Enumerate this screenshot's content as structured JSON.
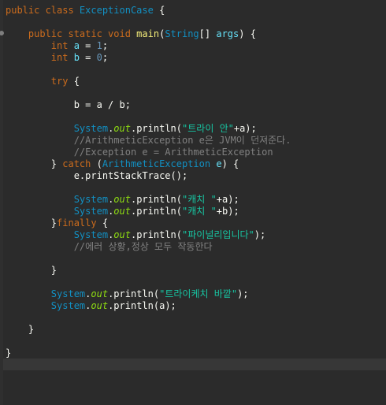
{
  "editor": {
    "language": "java",
    "background": "#2b2b2b",
    "lines": [
      {
        "segments": [
          {
            "t": "public class ",
            "c": "kw"
          },
          {
            "t": "ExceptionCase",
            "c": "cls"
          },
          {
            "t": " {",
            "c": "plain"
          }
        ]
      },
      {
        "segments": []
      },
      {
        "segments": [
          {
            "t": "    public static void ",
            "c": "kw"
          },
          {
            "t": "main",
            "c": "hlv"
          },
          {
            "t": "(",
            "c": "plain"
          },
          {
            "t": "String",
            "c": "cls"
          },
          {
            "t": "[] ",
            "c": "plain"
          },
          {
            "t": "args",
            "c": "var"
          },
          {
            "t": ") {",
            "c": "plain"
          }
        ]
      },
      {
        "segments": [
          {
            "t": "        int ",
            "c": "kw"
          },
          {
            "t": "a",
            "c": "var"
          },
          {
            "t": " = ",
            "c": "plain"
          },
          {
            "t": "1",
            "c": "num"
          },
          {
            "t": ";",
            "c": "plain"
          }
        ]
      },
      {
        "segments": [
          {
            "t": "        int ",
            "c": "kw"
          },
          {
            "t": "b",
            "c": "var"
          },
          {
            "t": " = ",
            "c": "plain"
          },
          {
            "t": "0",
            "c": "num"
          },
          {
            "t": ";",
            "c": "plain"
          }
        ]
      },
      {
        "segments": []
      },
      {
        "segments": [
          {
            "t": "        try",
            "c": "kw"
          },
          {
            "t": " {",
            "c": "plain"
          }
        ]
      },
      {
        "segments": []
      },
      {
        "segments": [
          {
            "t": "            b = a / b;",
            "c": "plain"
          }
        ]
      },
      {
        "segments": []
      },
      {
        "segments": [
          {
            "t": "            ",
            "c": "plain"
          },
          {
            "t": "System",
            "c": "cls"
          },
          {
            "t": ".",
            "c": "plain"
          },
          {
            "t": "out",
            "c": "fld"
          },
          {
            "t": ".println(",
            "c": "plain"
          },
          {
            "t": "\"트라이 안\"",
            "c": "str"
          },
          {
            "t": "+a);",
            "c": "plain"
          }
        ]
      },
      {
        "segments": [
          {
            "t": "            //ArithmeticException e은 JVM이 던져준다.",
            "c": "cmt"
          }
        ]
      },
      {
        "segments": [
          {
            "t": "            //Exception e = ArithmeticException",
            "c": "cmt"
          }
        ]
      },
      {
        "segments": [
          {
            "t": "        } ",
            "c": "plain"
          },
          {
            "t": "catch",
            "c": "kw"
          },
          {
            "t": " (",
            "c": "plain"
          },
          {
            "t": "ArithmeticException",
            "c": "cls"
          },
          {
            "t": " ",
            "c": "plain"
          },
          {
            "t": "e",
            "c": "var"
          },
          {
            "t": ") {",
            "c": "plain"
          }
        ]
      },
      {
        "segments": [
          {
            "t": "            e.printStackTrace();",
            "c": "plain"
          }
        ]
      },
      {
        "segments": []
      },
      {
        "segments": [
          {
            "t": "            ",
            "c": "plain"
          },
          {
            "t": "System",
            "c": "cls"
          },
          {
            "t": ".",
            "c": "plain"
          },
          {
            "t": "out",
            "c": "fld"
          },
          {
            "t": ".println(",
            "c": "plain"
          },
          {
            "t": "\"캐치 \"",
            "c": "str"
          },
          {
            "t": "+a);",
            "c": "plain"
          }
        ]
      },
      {
        "segments": [
          {
            "t": "            ",
            "c": "plain"
          },
          {
            "t": "System",
            "c": "cls"
          },
          {
            "t": ".",
            "c": "plain"
          },
          {
            "t": "out",
            "c": "fld"
          },
          {
            "t": ".println(",
            "c": "plain"
          },
          {
            "t": "\"캐치 \"",
            "c": "str"
          },
          {
            "t": "+b);",
            "c": "plain"
          }
        ]
      },
      {
        "segments": [
          {
            "t": "        }",
            "c": "plain"
          },
          {
            "t": "finally",
            "c": "kw"
          },
          {
            "t": " {",
            "c": "plain"
          }
        ]
      },
      {
        "segments": [
          {
            "t": "            ",
            "c": "plain"
          },
          {
            "t": "System",
            "c": "cls"
          },
          {
            "t": ".",
            "c": "plain"
          },
          {
            "t": "out",
            "c": "fld"
          },
          {
            "t": ".println(",
            "c": "plain"
          },
          {
            "t": "\"파이널리입니다\"",
            "c": "str"
          },
          {
            "t": ");",
            "c": "plain"
          }
        ]
      },
      {
        "segments": [
          {
            "t": "            //에러 상황,정상 모두 작동한다",
            "c": "cmt"
          }
        ]
      },
      {
        "segments": []
      },
      {
        "segments": [
          {
            "t": "        }",
            "c": "plain"
          }
        ]
      },
      {
        "segments": []
      },
      {
        "segments": [
          {
            "t": "        ",
            "c": "plain"
          },
          {
            "t": "System",
            "c": "cls"
          },
          {
            "t": ".",
            "c": "plain"
          },
          {
            "t": "out",
            "c": "fld"
          },
          {
            "t": ".println(",
            "c": "plain"
          },
          {
            "t": "\"트라이케치 바깥\"",
            "c": "str"
          },
          {
            "t": ");",
            "c": "plain"
          }
        ]
      },
      {
        "segments": [
          {
            "t": "        ",
            "c": "plain"
          },
          {
            "t": "System",
            "c": "cls"
          },
          {
            "t": ".",
            "c": "plain"
          },
          {
            "t": "out",
            "c": "fld"
          },
          {
            "t": ".println(a);",
            "c": "plain"
          }
        ]
      },
      {
        "segments": []
      },
      {
        "segments": [
          {
            "t": "    }",
            "c": "plain"
          }
        ]
      },
      {
        "segments": []
      },
      {
        "segments": [
          {
            "t": "}",
            "c": "plain"
          }
        ]
      }
    ]
  }
}
